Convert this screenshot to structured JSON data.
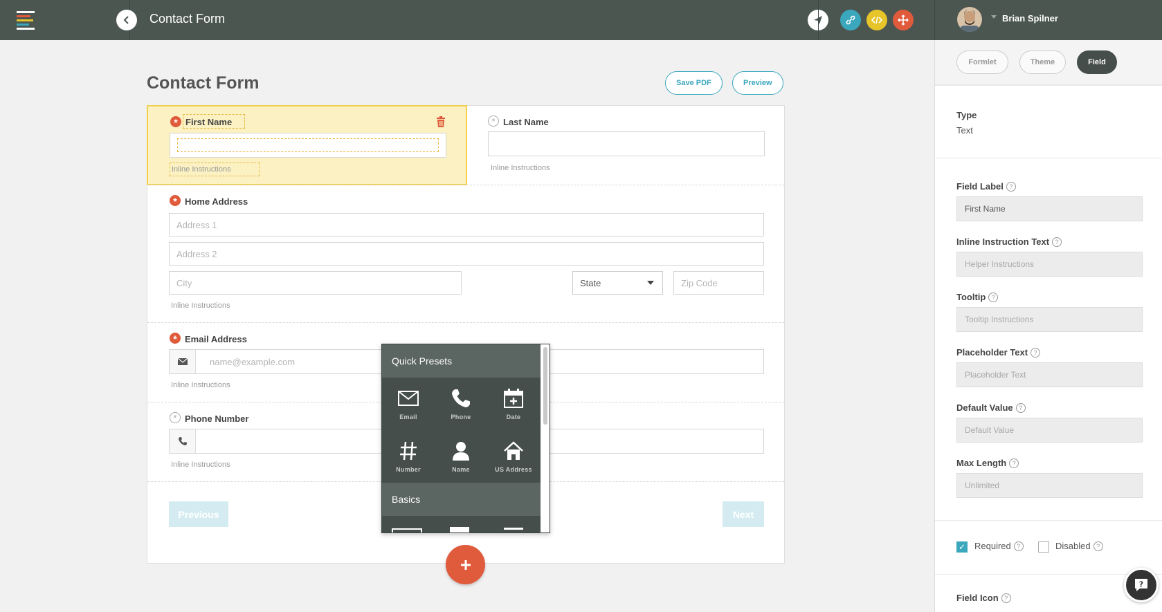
{
  "topbar": {
    "title": "Contact Form",
    "user_name": "Brian Spilner",
    "colors": {
      "bar": "#4c5651",
      "send": "#ffffff",
      "link": "#3aa7bd",
      "embed": "#e6c52a",
      "move": "#e05a3c"
    },
    "icons": [
      "menu-logo-icon",
      "back-arrow-icon",
      "send-icon",
      "link-icon",
      "code-icon",
      "move-icon"
    ]
  },
  "form": {
    "title": "Contact Form",
    "save_pdf": "Save PDF",
    "preview": "Preview",
    "fields": {
      "first_name": {
        "label": "First Name",
        "instructions": "Inline Instructions",
        "required": true
      },
      "last_name": {
        "label": "Last Name",
        "instructions": "Inline Instructions",
        "required": false
      },
      "home_address": {
        "label": "Home Address",
        "address1": "Address 1",
        "address2": "Address 2",
        "city": "City",
        "state": "State",
        "zip": "Zip Code",
        "instructions": "Inline Instructions",
        "required": true
      },
      "email": {
        "label": "Email Address",
        "placeholder": "name@example.com",
        "instructions": "Inline Instructions",
        "required": true
      },
      "phone": {
        "label": "Phone Number",
        "instructions": "Inline Instructions",
        "required": false
      }
    },
    "previous": "Previous",
    "next": "Next"
  },
  "popup": {
    "quick_presets": "Quick Presets",
    "basics": "Basics",
    "presets": [
      {
        "label": "Email",
        "icon": "envelope-icon"
      },
      {
        "label": "Phone",
        "icon": "phone-icon"
      },
      {
        "label": "Date",
        "icon": "calendar-icon"
      },
      {
        "label": "Number",
        "icon": "hash-icon"
      },
      {
        "label": "Name",
        "icon": "person-icon"
      },
      {
        "label": "US Address",
        "icon": "house-icon"
      }
    ]
  },
  "panel": {
    "tabs": [
      "Formlet",
      "Theme",
      "Field"
    ],
    "type_label": "Type",
    "type_value": "Text",
    "field_label": {
      "label": "Field Label",
      "value": "First Name"
    },
    "inline_instruction": {
      "label": "Inline Instruction Text",
      "placeholder": "Helper Instructions"
    },
    "tooltip": {
      "label": "Tooltip",
      "placeholder": "Tooltip Instructions"
    },
    "placeholder_text": {
      "label": "Placeholder Text",
      "placeholder": "Placeholder Text"
    },
    "default_value": {
      "label": "Default Value",
      "placeholder": "Default Value"
    },
    "max_length": {
      "label": "Max Length",
      "placeholder": "Unlimited"
    },
    "required": {
      "label": "Required",
      "checked": true
    },
    "disabled": {
      "label": "Disabled",
      "checked": false
    },
    "field_icon": "Field Icon",
    "help_glyph": "?"
  }
}
